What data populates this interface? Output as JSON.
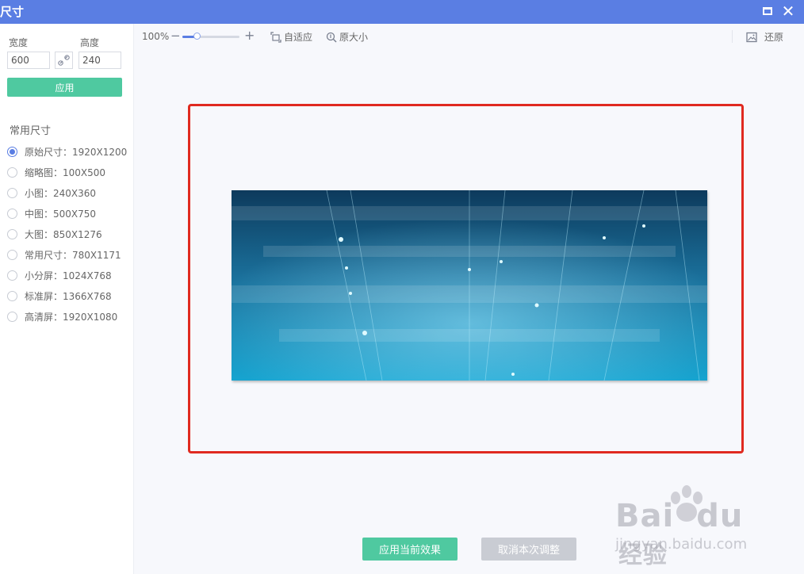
{
  "window": {
    "title": "尺寸"
  },
  "sidebar": {
    "width_label": "宽度",
    "height_label": "高度",
    "width_value": "600",
    "height_value": "240",
    "apply_label": "应用",
    "common_sizes_title": "常用尺寸",
    "sizes": [
      {
        "label": "原始尺寸：1920X1200",
        "selected": true
      },
      {
        "label": "缩略图：100X500",
        "selected": false
      },
      {
        "label": "小图：240X360",
        "selected": false
      },
      {
        "label": "中图：500X750",
        "selected": false
      },
      {
        "label": "大图：850X1276",
        "selected": false
      },
      {
        "label": "常用尺寸：780X1171",
        "selected": false
      },
      {
        "label": "小分屏：1024X768",
        "selected": false
      },
      {
        "label": "标准屏：1366X768",
        "selected": false
      },
      {
        "label": "高清屏：1920X1080",
        "selected": false
      }
    ]
  },
  "toolbar": {
    "zoom_value": "100%",
    "zoom_slider_fraction": 0.25,
    "fit_label": "自适应",
    "original_size_label": "原大小",
    "restore_label": "还原"
  },
  "actions": {
    "apply_effect_label": "应用当前效果",
    "cancel_adjust_label": "取消本次调整"
  },
  "watermark": {
    "brand": "Bai",
    "brand_mid": "du",
    "brand_cn": "经验",
    "url": "jingyan.baidu.com"
  },
  "colors": {
    "titlebar": "#5a7ee3",
    "accent_green": "#4fc9a0",
    "highlight_red": "#e02a20",
    "button_disabled": "#c9ccd3"
  }
}
